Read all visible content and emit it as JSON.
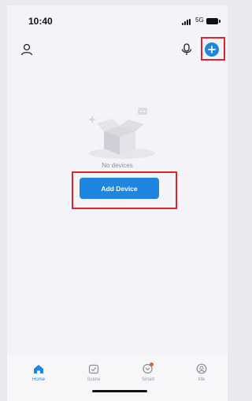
{
  "status_bar": {
    "time": "10:40",
    "network": "5G"
  },
  "header": {
    "profile_icon": "user-icon",
    "voice_icon": "mic-icon",
    "add_icon": "plus-circle-icon"
  },
  "main": {
    "empty_text": "No devices",
    "add_device_label": "Add Device"
  },
  "tabs": [
    {
      "label": "Home",
      "icon": "home-icon",
      "active": true
    },
    {
      "label": "Scene",
      "icon": "scene-icon",
      "active": false
    },
    {
      "label": "Smart",
      "icon": "smart-icon",
      "active": false,
      "badge": true
    },
    {
      "label": "Me",
      "icon": "me-icon",
      "active": false
    }
  ],
  "colors": {
    "accent": "#1f86e0",
    "highlight": "#e0242b",
    "badge": "#f5533d"
  }
}
